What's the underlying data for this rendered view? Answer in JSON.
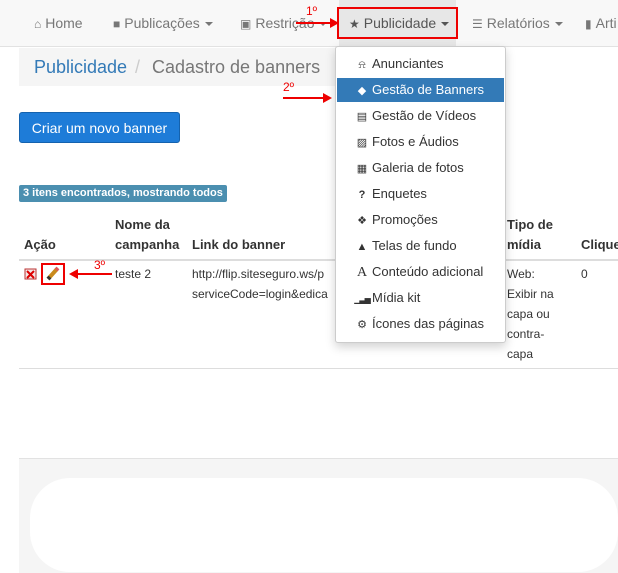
{
  "navbar": {
    "items": [
      {
        "label": "Home",
        "icon": "home-icon",
        "glyph": "⌂"
      },
      {
        "label": "Publicações",
        "icon": "file-icon",
        "glyph": "■"
      },
      {
        "label": "Restrição",
        "icon": "lock-icon",
        "glyph": "▣"
      },
      {
        "label": "Publicidade",
        "icon": "star-icon",
        "glyph": "★"
      },
      {
        "label": "Relatórios",
        "icon": "list-icon",
        "glyph": "☰"
      },
      {
        "label": "Arti",
        "icon": "bookmark-icon",
        "glyph": "▮"
      }
    ]
  },
  "breadcrumb": {
    "first": "Publicidade",
    "separator": "/",
    "current": "Cadastro de banners"
  },
  "create_button": "Criar um novo banner",
  "results_badge": "3 itens encontrados, mostrando todos",
  "table": {
    "headers": [
      "Ação",
      "Nome da campanha",
      "Link do banner",
      "Tipo de mídia",
      "Clique"
    ],
    "row": {
      "name": "teste 2",
      "link_line1": "http://flip.siteseguro.ws/p",
      "link_line2": "serviceCode=login&edica",
      "media": [
        "Web:",
        "Exibir na",
        "capa ou",
        "contra-",
        "capa"
      ],
      "clicks": "0"
    }
  },
  "dropdown": {
    "items": [
      {
        "label": "Anunciantes",
        "icon": "bell-icon",
        "glyph": "⍾"
      },
      {
        "label": "Gestão de Banners",
        "icon": "tags-icon",
        "glyph": "◆"
      },
      {
        "label": "Gestão de Vídeos",
        "icon": "film-icon",
        "glyph": "▤"
      },
      {
        "label": "Fotos e Áudios",
        "icon": "picture-icon",
        "glyph": "▨"
      },
      {
        "label": "Galeria de fotos",
        "icon": "th-large-icon",
        "glyph": "▦"
      },
      {
        "label": "Enquetes",
        "icon": "question-sign-icon",
        "glyph": "?"
      },
      {
        "label": "Promoções",
        "icon": "gift-icon",
        "glyph": "❖"
      },
      {
        "label": "Telas de fundo",
        "icon": "tint-icon",
        "glyph": "▲"
      },
      {
        "label": "Conteúdo adicional",
        "icon": "font-icon",
        "glyph": "A"
      },
      {
        "label": "Mídia kit",
        "icon": "signal-icon",
        "glyph": "▁▃▅"
      },
      {
        "label": "Ícones das páginas",
        "icon": "cog-icon",
        "glyph": "⚙"
      }
    ]
  },
  "annotations": {
    "step1": "1º",
    "step2": "2º",
    "step3": "3º"
  },
  "colors": {
    "annotation_red": "#e00000",
    "primary_blue": "#337ab7",
    "button_blue": "#1e7cd8",
    "badge_teal": "#4b8fb0"
  }
}
